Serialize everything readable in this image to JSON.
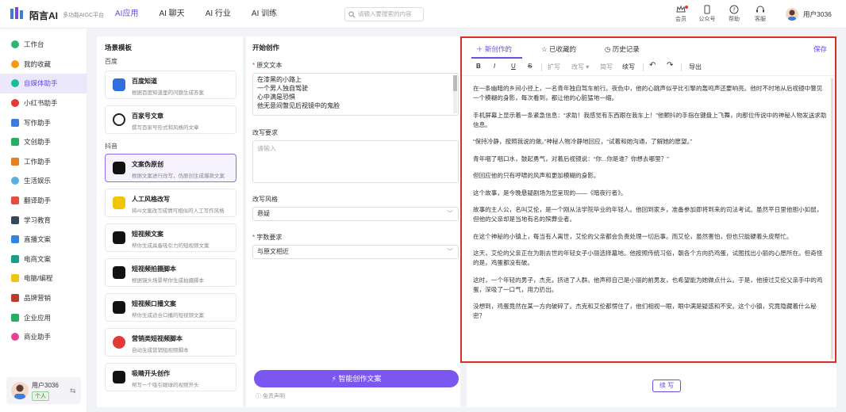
{
  "app": {
    "name": "陌言AI",
    "subtitle": "多功能AIGC平台"
  },
  "top_nav": [
    {
      "label": "AI应用",
      "active": true
    },
    {
      "label": "AI 聊天",
      "active": false
    },
    {
      "label": "AI 行业",
      "active": false
    },
    {
      "label": "AI 训练",
      "active": false
    }
  ],
  "search": {
    "placeholder": "请输入要搜索的内容"
  },
  "top_icons": [
    {
      "label": "会员",
      "icon": "crown-icon"
    },
    {
      "label": "公众号",
      "icon": "phone-icon"
    },
    {
      "label": "帮助",
      "icon": "help-icon"
    },
    {
      "label": "客服",
      "icon": "headset-icon"
    }
  ],
  "user": {
    "name": "用户3036",
    "badge": "个人"
  },
  "sidebar": [
    {
      "label": "工作台",
      "color": "#2bb673",
      "active": false
    },
    {
      "label": "我的收藏",
      "color": "#f39c12",
      "active": false
    },
    {
      "label": "自媒体助手",
      "color": "#1abc9c",
      "active": true
    },
    {
      "label": "小红书助手",
      "color": "#e53935",
      "active": false
    },
    {
      "label": "写作助手",
      "color": "#3b7ddd",
      "active": false
    },
    {
      "label": "文创助手",
      "color": "#27ae60",
      "active": false
    },
    {
      "label": "工作助手",
      "color": "#e67e22",
      "active": false
    },
    {
      "label": "生活娱乐",
      "color": "#5dade2",
      "active": false
    },
    {
      "label": "翻译助手",
      "color": "#e74c3c",
      "active": false
    },
    {
      "label": "学习教育",
      "color": "#34495e",
      "active": false
    },
    {
      "label": "直播文案",
      "color": "#2e86de",
      "active": false
    },
    {
      "label": "电商文案",
      "color": "#16a085",
      "active": false
    },
    {
      "label": "电脑/编程",
      "color": "#f1c40f",
      "active": false
    },
    {
      "label": "品牌营销",
      "color": "#c0392b",
      "active": false
    },
    {
      "label": "企业应用",
      "color": "#27ae60",
      "active": false
    },
    {
      "label": "商业助手",
      "color": "#e84393",
      "active": false
    }
  ],
  "templates": {
    "title": "场景模板",
    "groups": [
      {
        "name": "百度",
        "items": [
          {
            "title": "百度知道",
            "desc": "根据百度知道里的问题生成答案",
            "color": "#2f6fe0",
            "active": false
          },
          {
            "title": "百家号文章",
            "desc": "撰写百家号形式和风格的文章",
            "color": "#222222",
            "active": false
          }
        ]
      },
      {
        "name": "抖音",
        "items": [
          {
            "title": "文案伪原创",
            "desc": "根据文案进行改写，伪原创生成爆款文案",
            "color": "#111111",
            "active": true
          },
          {
            "title": "人工风格改写",
            "desc": "将AI文案改写成情可相似的人工写作风格",
            "color": "#f2c500",
            "active": false
          },
          {
            "title": "短视频文案",
            "desc": "帮你生成具备吸引力的短视频文案",
            "color": "#111111",
            "active": false
          },
          {
            "title": "短视频拍摄脚本",
            "desc": "根据镜头场景帮你生成拍摄脚本",
            "color": "#111111",
            "active": false
          },
          {
            "title": "短视频口播文案",
            "desc": "帮你生成适合口播的短视频文案",
            "color": "#111111",
            "active": false
          },
          {
            "title": "营销类短视频脚本",
            "desc": "自动生成营销短视频脚本",
            "color": "#e53935",
            "active": false
          },
          {
            "title": "吸睛开头创作",
            "desc": "帮写一个吸引眼球的视频开头",
            "color": "#111111",
            "active": false
          }
        ]
      }
    ]
  },
  "form": {
    "title": "开始创作",
    "source_label": "原文文本",
    "source_lines": [
      "在漆黑的小路上",
      "一个男人独自驾驶",
      "心中满是恐惧",
      "他无意间瞥见后视镜中的鬼脸"
    ],
    "requirement_label": "改写要求",
    "requirement_placeholder": "请输入",
    "style_label": "改写风格",
    "style_value": "悬疑",
    "length_label": "字数要求",
    "length_value": "与原文相近",
    "generate_label": "智能创作文案",
    "disclaimer": "免责声明"
  },
  "editor": {
    "tabs": [
      {
        "label": "新创作的",
        "active": true
      },
      {
        "label": "已收藏的",
        "active": false
      },
      {
        "label": "历史记录",
        "active": false
      }
    ],
    "save_label": "保存",
    "toolbar": {
      "bold": "B",
      "italic": "I",
      "underline": "U",
      "strike": "S",
      "expand": "扩写",
      "rewrite": "改写",
      "shorten": "简写",
      "continue": "续写",
      "export": "导出"
    },
    "paragraphs": [
      "在一条幽暗的乡间小径上，一名青年独自驾车前行。夜色中，他的心跳声似乎比引擎的轰鸣声还要响亮。他时不时地从后视镜中瞥见一个模糊的身影，每次看到，都让他的心脏猛地一缩。",
      "手机屏幕上显示着一条紧急信息：“求助！我感觉有东西跟在我车上！”他颤抖的手指在键盘上飞舞，向那位传说中的神秘人物发送求助信息。",
      "“保持冷静，按照我说的做。”神秘人物冷静地回应，“试着和她沟通，了解她的愿望。”",
      "青年咽了咽口水，鼓起勇气，对着后视镜说：“你...你是谁？你想去哪里？”",
      "但回应他的只有呼啸的风声和更加模糊的身影。",
      "这个故事，是今晚悬疑剧场为您呈现的——《暗夜行者》。",
      "故事的主人公，名叫艾伦，是一个刚从法学院毕业的年轻人。他回到家乡，准备参加即将到来的司法考试。虽然平日里他胆小如鼠，但他的父亲却是当地有名的殡葬业者。",
      "在这个神秘的小镇上，每当有人离世，艾伦的父亲都会负责处理一切后事。而艾伦，虽然害怕，但也只能硬着头皮帮忙。",
      "这天，艾伦的父亲正在为刚去世的年轻女子小丽选择墓地。他按照传统习俗，朝各个方向扔鸡蛋，试图找出小丽的心愿所在。但奇怪的是，鸡蛋都没有破。",
      "这时，一个年轻的男子，杰克，挤进了人群。他声称自己是小丽的前男友，也希望能为她做点什么。于是，他接过艾伦父亲手中的鸡蛋，深吸了一口气，用力扔出。",
      "没想到，鸡蛋竟然在某一方向破碎了。杰克和艾伦都愣住了，他们相视一眼，眼中满是疑惑和不安。这个小镇，究竟隐藏着什么秘密？"
    ],
    "continue_button": "续 写"
  }
}
